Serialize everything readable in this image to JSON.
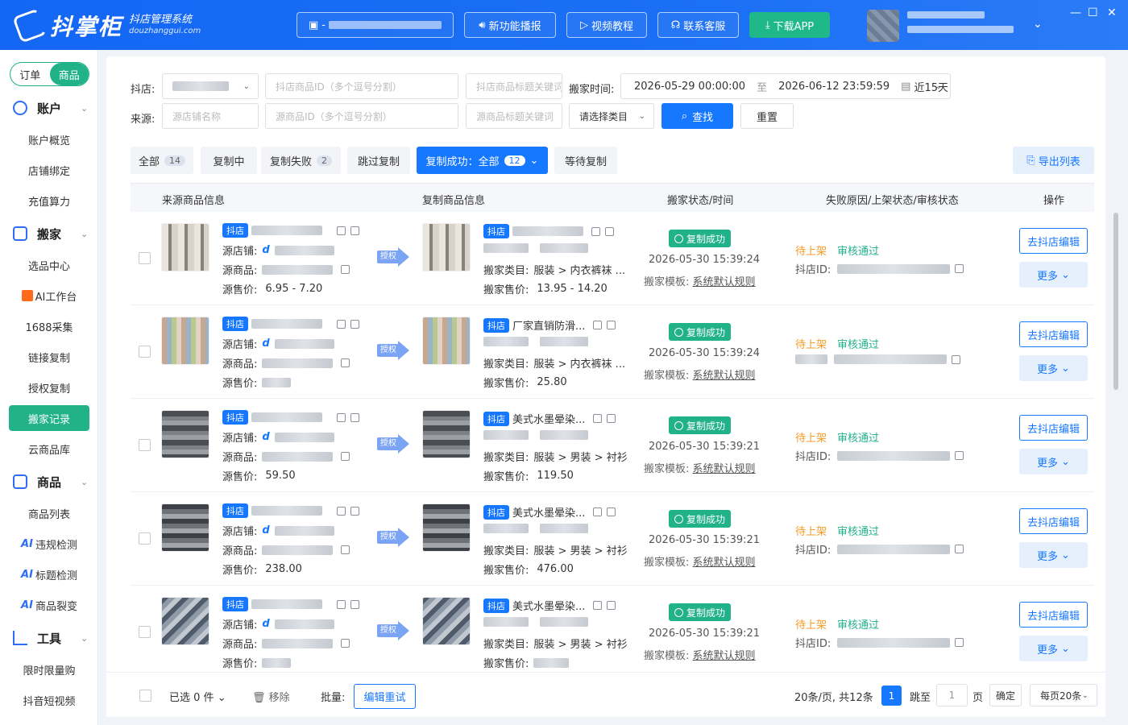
{
  "header": {
    "logo_name": "抖掌柜",
    "logo_subtitle": "抖店管理系统",
    "logo_domain": "douzhanggui.com",
    "new_feature_label": "新功能播报",
    "video_tutorial_label": "视频教程",
    "contact_service_label": "联系客服",
    "download_app_label": "下载APP",
    "store_selector_prefix": "-",
    "minimize_icon": "minimize-icon",
    "maximize_icon": "maximize-icon",
    "close_icon": "close-icon"
  },
  "sidebar": {
    "segments": [
      "订单",
      "商品"
    ],
    "active_segment": "商品",
    "groups": [
      {
        "label": "账户",
        "items": [
          "账户概览",
          "店铺绑定",
          "充值算力"
        ]
      },
      {
        "label": "搬家",
        "items": [
          "选品中心",
          "AI工作台",
          "1688采集",
          "链接复制",
          "授权复制",
          "搬家记录",
          "云商品库"
        ]
      },
      {
        "label": "商品",
        "items": [
          "商品列表",
          "违规检测",
          "标题检测",
          "商品裂变"
        ]
      },
      {
        "label": "工具",
        "items": [
          "限时限量购",
          "抖音短视频"
        ]
      }
    ],
    "active_item": "搬家记录",
    "ai_prefix": "AI"
  },
  "filters": {
    "shop_label": "抖店:",
    "source_label": "来源:",
    "shop_product_id_placeholder": "抖店商品ID（多个逗号分割）",
    "shop_product_title_placeholder": "抖店商品标题关键词",
    "move_time_label": "搬家时间:",
    "start_time": "2026-05-29 00:00:00",
    "to_label": "至",
    "end_time": "2026-06-12 23:59:59",
    "quick_range": "近15天",
    "source_shop_placeholder": "源店铺名称",
    "source_product_id_placeholder": "源商品ID（多个逗号分割）",
    "source_product_title_placeholder": "源商品标题关键词",
    "category_placeholder": "请选择类目",
    "search_label": "查找",
    "reset_label": "重置"
  },
  "tabs": [
    {
      "label": "全部",
      "count": "14"
    },
    {
      "label": "复制中",
      "count": ""
    },
    {
      "label": "复制失败",
      "count": "2"
    },
    {
      "label": "跳过复制",
      "count": ""
    },
    {
      "label": "复制成功：全部",
      "count": "12"
    },
    {
      "label": "等待复制",
      "count": ""
    }
  ],
  "active_tab": "复制成功：全部",
  "export_label": "导出列表",
  "table": {
    "columns": [
      "来源商品信息",
      "复制商品信息",
      "搬家状态/时间",
      "失败原因/上架状态/审核状态",
      "操作"
    ],
    "labels": {
      "platform_badge": "抖店",
      "source_shop": "源店铺:",
      "source_product": "源商品:",
      "source_price": "源售价:",
      "move_category": "搬家类目:",
      "move_price": "搬家售价:",
      "move_template": "搬家模板:",
      "template_link": "系统默认规则",
      "shop_id": "抖店ID:",
      "authorize": "授权",
      "edit_btn": "去抖店编辑",
      "more_btn": "更多"
    },
    "rows": [
      {
        "source_price": "6.95 - 7.20",
        "copy_title": "",
        "category": "服装 > 内衣裤袜 ...",
        "move_price": "13.95 - 14.20",
        "status": "复制成功",
        "time": "2026-05-30 15:39:24",
        "listing": "待上架",
        "review": "审核通过",
        "show_shop_id_label": true
      },
      {
        "source_price": "",
        "copy_title": "厂家直销防滑...",
        "category": "服装 > 内衣裤袜 ...",
        "move_price": "25.80",
        "status": "复制成功",
        "time": "2026-05-30 15:39:24",
        "listing": "待上架",
        "review": "审核通过",
        "show_shop_id_label": false
      },
      {
        "source_price": "59.50",
        "copy_title": "美式水墨晕染...",
        "category": "服装 > 男装 > 衬衫",
        "move_price": "119.50",
        "status": "复制成功",
        "time": "2026-05-30 15:39:21",
        "listing": "待上架",
        "review": "审核通过",
        "show_shop_id_label": true
      },
      {
        "source_price": "238.00",
        "copy_title": "美式水墨晕染...",
        "category": "服装 > 男装 > 衬衫",
        "move_price": "476.00",
        "status": "复制成功",
        "time": "2026-05-30 15:39:21",
        "listing": "待上架",
        "review": "审核通过",
        "show_shop_id_label": true
      },
      {
        "source_price": "",
        "copy_title": "美式水墨晕染...",
        "category": "服装 > 男装 > 衬衫",
        "move_price": "",
        "status": "复制成功",
        "time": "2026-05-30 15:39:21",
        "listing": "待上架",
        "review": "审核通过",
        "show_shop_id_label": true
      }
    ]
  },
  "footer": {
    "selected": "已选 0 件",
    "remove": "移除",
    "batch": "批量:",
    "edit_retry": "编辑重试",
    "page_info": "20条/页, 共12条",
    "current_page": "1",
    "jump_to": "跳至",
    "page_input": "1",
    "page_unit": "页",
    "confirm": "确定",
    "page_size": "每页20条"
  },
  "colors": {
    "primary": "#1677ff",
    "green": "#21b28a",
    "orange": "#f59a23"
  }
}
